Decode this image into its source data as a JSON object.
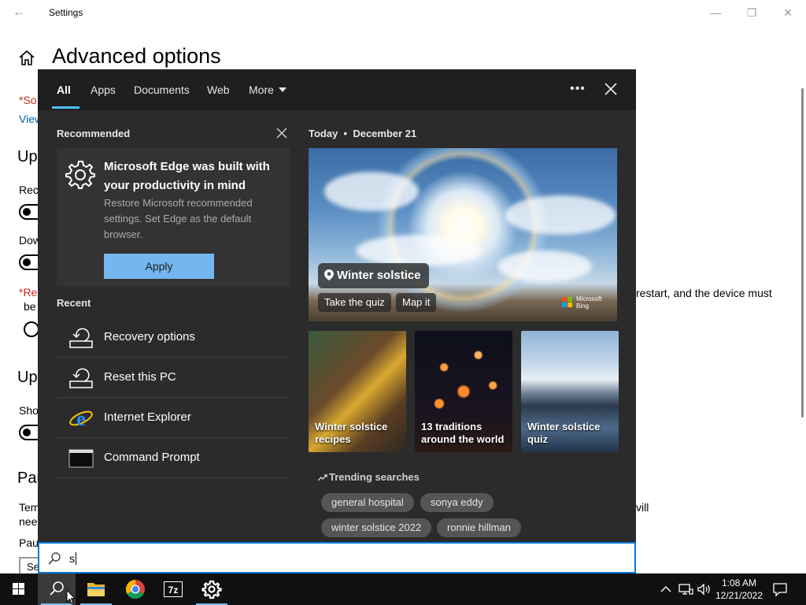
{
  "window": {
    "title": "Settings",
    "page_title": "Advanced options",
    "bg_lines": {
      "red1": "*So",
      "link1": "View",
      "heading1": "Up",
      "line_rec": "Rec",
      "line_dow": "Dow",
      "red2": "*Re",
      "line_be": "be",
      "right_restart": "restart, and the device must",
      "heading2": "Up",
      "line_sho": "Sho",
      "heading3": "Pau",
      "line_tem": "Tem",
      "line_nee": "nee",
      "right_will": "vill",
      "line_pau": "Pau",
      "select_text": "Se"
    }
  },
  "search_flyout": {
    "tabs": [
      "All",
      "Apps",
      "Documents",
      "Web",
      "More"
    ],
    "recommended": {
      "label": "Recommended",
      "title": "Microsoft Edge was built with your productivity in mind",
      "description": "Restore Microsoft recommended settings. Set Edge as the default browser.",
      "button": "Apply"
    },
    "recent": {
      "label": "Recent",
      "items": [
        {
          "label": "Recovery options",
          "icon": "recovery-icon"
        },
        {
          "label": "Reset this PC",
          "icon": "reset-icon"
        },
        {
          "label": "Internet Explorer",
          "icon": "internet-explorer-icon"
        },
        {
          "label": "Command Prompt",
          "icon": "command-prompt-icon"
        }
      ]
    },
    "today": {
      "prefix": "Today",
      "date": "December 21",
      "hero_title": "Winter solstice",
      "hero_actions": [
        "Take the quiz",
        "Map it"
      ],
      "brand": "Microsoft Bing",
      "tiles": [
        "Winter solstice recipes",
        "13 traditions around the world",
        "Winter solstice quiz"
      ]
    },
    "trending": {
      "label": "Trending searches",
      "chips": [
        "general hospital",
        "sonya eddy",
        "winter solstice 2022",
        "ronnie hillman"
      ]
    },
    "search_query": "s"
  },
  "taskbar": {
    "time": "1:08 AM",
    "date": "12/21/2022",
    "apps": [
      "windows-start",
      "search",
      "file-explorer",
      "google-chrome",
      "7-zip",
      "settings"
    ]
  },
  "colors": {
    "flyout_bg": "#2b2b2b",
    "accent": "#0078d4",
    "apply_button": "#74b7ee",
    "taskbar": "#101010"
  }
}
